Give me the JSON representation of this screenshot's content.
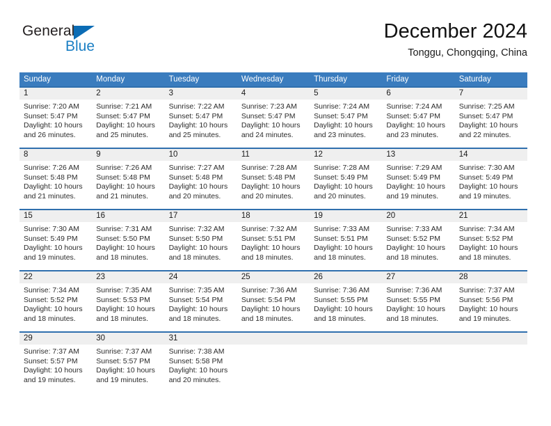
{
  "brand": {
    "name_top": "General",
    "name_bottom": "Blue",
    "accent_color": "#1b7fc4",
    "triangle_color": "#0b6cb5"
  },
  "header": {
    "title": "December 2024",
    "subtitle": "Tonggu, Chongqing, China"
  },
  "theme": {
    "header_row_bg": "#3a7cbe",
    "week_separator": "#2f6fae",
    "day_band_bg": "#efefef",
    "text_color": "#2b2b2b"
  },
  "weekday_headers": [
    "Sunday",
    "Monday",
    "Tuesday",
    "Wednesday",
    "Thursday",
    "Friday",
    "Saturday"
  ],
  "labels": {
    "sunrise_prefix": "Sunrise:",
    "sunset_prefix": "Sunset:",
    "daylight_prefix": "Daylight:"
  },
  "weeks": [
    [
      {
        "day": "1",
        "sunrise": "Sunrise: 7:20 AM",
        "sunset": "Sunset: 5:47 PM",
        "daylight_line1": "Daylight: 10 hours",
        "daylight_line2": "and 26 minutes."
      },
      {
        "day": "2",
        "sunrise": "Sunrise: 7:21 AM",
        "sunset": "Sunset: 5:47 PM",
        "daylight_line1": "Daylight: 10 hours",
        "daylight_line2": "and 25 minutes."
      },
      {
        "day": "3",
        "sunrise": "Sunrise: 7:22 AM",
        "sunset": "Sunset: 5:47 PM",
        "daylight_line1": "Daylight: 10 hours",
        "daylight_line2": "and 25 minutes."
      },
      {
        "day": "4",
        "sunrise": "Sunrise: 7:23 AM",
        "sunset": "Sunset: 5:47 PM",
        "daylight_line1": "Daylight: 10 hours",
        "daylight_line2": "and 24 minutes."
      },
      {
        "day": "5",
        "sunrise": "Sunrise: 7:24 AM",
        "sunset": "Sunset: 5:47 PM",
        "daylight_line1": "Daylight: 10 hours",
        "daylight_line2": "and 23 minutes."
      },
      {
        "day": "6",
        "sunrise": "Sunrise: 7:24 AM",
        "sunset": "Sunset: 5:47 PM",
        "daylight_line1": "Daylight: 10 hours",
        "daylight_line2": "and 23 minutes."
      },
      {
        "day": "7",
        "sunrise": "Sunrise: 7:25 AM",
        "sunset": "Sunset: 5:47 PM",
        "daylight_line1": "Daylight: 10 hours",
        "daylight_line2": "and 22 minutes."
      }
    ],
    [
      {
        "day": "8",
        "sunrise": "Sunrise: 7:26 AM",
        "sunset": "Sunset: 5:48 PM",
        "daylight_line1": "Daylight: 10 hours",
        "daylight_line2": "and 21 minutes."
      },
      {
        "day": "9",
        "sunrise": "Sunrise: 7:26 AM",
        "sunset": "Sunset: 5:48 PM",
        "daylight_line1": "Daylight: 10 hours",
        "daylight_line2": "and 21 minutes."
      },
      {
        "day": "10",
        "sunrise": "Sunrise: 7:27 AM",
        "sunset": "Sunset: 5:48 PM",
        "daylight_line1": "Daylight: 10 hours",
        "daylight_line2": "and 20 minutes."
      },
      {
        "day": "11",
        "sunrise": "Sunrise: 7:28 AM",
        "sunset": "Sunset: 5:48 PM",
        "daylight_line1": "Daylight: 10 hours",
        "daylight_line2": "and 20 minutes."
      },
      {
        "day": "12",
        "sunrise": "Sunrise: 7:28 AM",
        "sunset": "Sunset: 5:49 PM",
        "daylight_line1": "Daylight: 10 hours",
        "daylight_line2": "and 20 minutes."
      },
      {
        "day": "13",
        "sunrise": "Sunrise: 7:29 AM",
        "sunset": "Sunset: 5:49 PM",
        "daylight_line1": "Daylight: 10 hours",
        "daylight_line2": "and 19 minutes."
      },
      {
        "day": "14",
        "sunrise": "Sunrise: 7:30 AM",
        "sunset": "Sunset: 5:49 PM",
        "daylight_line1": "Daylight: 10 hours",
        "daylight_line2": "and 19 minutes."
      }
    ],
    [
      {
        "day": "15",
        "sunrise": "Sunrise: 7:30 AM",
        "sunset": "Sunset: 5:49 PM",
        "daylight_line1": "Daylight: 10 hours",
        "daylight_line2": "and 19 minutes."
      },
      {
        "day": "16",
        "sunrise": "Sunrise: 7:31 AM",
        "sunset": "Sunset: 5:50 PM",
        "daylight_line1": "Daylight: 10 hours",
        "daylight_line2": "and 18 minutes."
      },
      {
        "day": "17",
        "sunrise": "Sunrise: 7:32 AM",
        "sunset": "Sunset: 5:50 PM",
        "daylight_line1": "Daylight: 10 hours",
        "daylight_line2": "and 18 minutes."
      },
      {
        "day": "18",
        "sunrise": "Sunrise: 7:32 AM",
        "sunset": "Sunset: 5:51 PM",
        "daylight_line1": "Daylight: 10 hours",
        "daylight_line2": "and 18 minutes."
      },
      {
        "day": "19",
        "sunrise": "Sunrise: 7:33 AM",
        "sunset": "Sunset: 5:51 PM",
        "daylight_line1": "Daylight: 10 hours",
        "daylight_line2": "and 18 minutes."
      },
      {
        "day": "20",
        "sunrise": "Sunrise: 7:33 AM",
        "sunset": "Sunset: 5:52 PM",
        "daylight_line1": "Daylight: 10 hours",
        "daylight_line2": "and 18 minutes."
      },
      {
        "day": "21",
        "sunrise": "Sunrise: 7:34 AM",
        "sunset": "Sunset: 5:52 PM",
        "daylight_line1": "Daylight: 10 hours",
        "daylight_line2": "and 18 minutes."
      }
    ],
    [
      {
        "day": "22",
        "sunrise": "Sunrise: 7:34 AM",
        "sunset": "Sunset: 5:52 PM",
        "daylight_line1": "Daylight: 10 hours",
        "daylight_line2": "and 18 minutes."
      },
      {
        "day": "23",
        "sunrise": "Sunrise: 7:35 AM",
        "sunset": "Sunset: 5:53 PM",
        "daylight_line1": "Daylight: 10 hours",
        "daylight_line2": "and 18 minutes."
      },
      {
        "day": "24",
        "sunrise": "Sunrise: 7:35 AM",
        "sunset": "Sunset: 5:54 PM",
        "daylight_line1": "Daylight: 10 hours",
        "daylight_line2": "and 18 minutes."
      },
      {
        "day": "25",
        "sunrise": "Sunrise: 7:36 AM",
        "sunset": "Sunset: 5:54 PM",
        "daylight_line1": "Daylight: 10 hours",
        "daylight_line2": "and 18 minutes."
      },
      {
        "day": "26",
        "sunrise": "Sunrise: 7:36 AM",
        "sunset": "Sunset: 5:55 PM",
        "daylight_line1": "Daylight: 10 hours",
        "daylight_line2": "and 18 minutes."
      },
      {
        "day": "27",
        "sunrise": "Sunrise: 7:36 AM",
        "sunset": "Sunset: 5:55 PM",
        "daylight_line1": "Daylight: 10 hours",
        "daylight_line2": "and 18 minutes."
      },
      {
        "day": "28",
        "sunrise": "Sunrise: 7:37 AM",
        "sunset": "Sunset: 5:56 PM",
        "daylight_line1": "Daylight: 10 hours",
        "daylight_line2": "and 19 minutes."
      }
    ],
    [
      {
        "day": "29",
        "sunrise": "Sunrise: 7:37 AM",
        "sunset": "Sunset: 5:57 PM",
        "daylight_line1": "Daylight: 10 hours",
        "daylight_line2": "and 19 minutes."
      },
      {
        "day": "30",
        "sunrise": "Sunrise: 7:37 AM",
        "sunset": "Sunset: 5:57 PM",
        "daylight_line1": "Daylight: 10 hours",
        "daylight_line2": "and 19 minutes."
      },
      {
        "day": "31",
        "sunrise": "Sunrise: 7:38 AM",
        "sunset": "Sunset: 5:58 PM",
        "daylight_line1": "Daylight: 10 hours",
        "daylight_line2": "and 20 minutes."
      },
      {
        "day": "",
        "sunrise": "",
        "sunset": "",
        "daylight_line1": "",
        "daylight_line2": ""
      },
      {
        "day": "",
        "sunrise": "",
        "sunset": "",
        "daylight_line1": "",
        "daylight_line2": ""
      },
      {
        "day": "",
        "sunrise": "",
        "sunset": "",
        "daylight_line1": "",
        "daylight_line2": ""
      },
      {
        "day": "",
        "sunrise": "",
        "sunset": "",
        "daylight_line1": "",
        "daylight_line2": ""
      }
    ]
  ]
}
